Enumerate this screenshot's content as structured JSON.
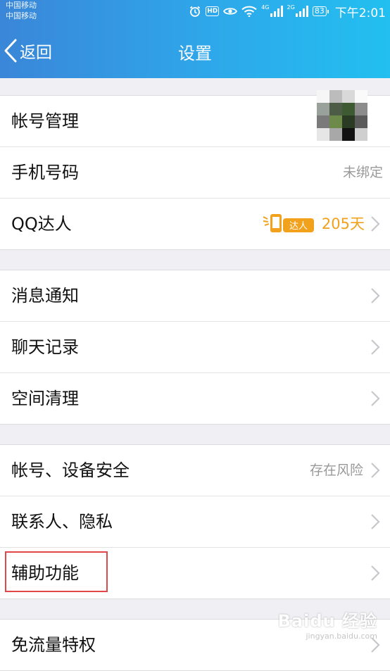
{
  "status_bar": {
    "carrier_1": "中国移动",
    "carrier_2": "中国移动",
    "hd_badge": "HD",
    "net_1": "4G",
    "net_2": "2G",
    "battery": "83",
    "time": "下午2:01",
    "icons": [
      "alarm-icon",
      "hd-icon",
      "eye-icon",
      "wifi-icon",
      "signal-icon",
      "signal-icon",
      "battery-icon"
    ]
  },
  "nav": {
    "back_label": "返回",
    "title": "设置"
  },
  "groups": [
    {
      "rows": [
        {
          "label": "帐号管理",
          "value": ""
        },
        {
          "label": "手机号码",
          "value": "未绑定"
        },
        {
          "label": "QQ达人",
          "value": "205天",
          "badge": "达人"
        }
      ]
    },
    {
      "rows": [
        {
          "label": "消息通知"
        },
        {
          "label": "聊天记录"
        },
        {
          "label": "空间清理"
        }
      ]
    },
    {
      "rows": [
        {
          "label": "帐号、设备安全",
          "value": "存在风险"
        },
        {
          "label": "联系人、隐私"
        },
        {
          "label": "辅助功能"
        }
      ]
    },
    {
      "rows": [
        {
          "label": "免流量特权"
        }
      ]
    }
  ],
  "watermark": {
    "main": "Baidu 经验",
    "sub": "jingyan.baidu.com"
  },
  "colors": {
    "nav_gradient_start": "#3a86d8",
    "nav_gradient_end": "#22bff0",
    "talent_gold": "#f1a11b",
    "highlight_red": "#e0474a"
  }
}
